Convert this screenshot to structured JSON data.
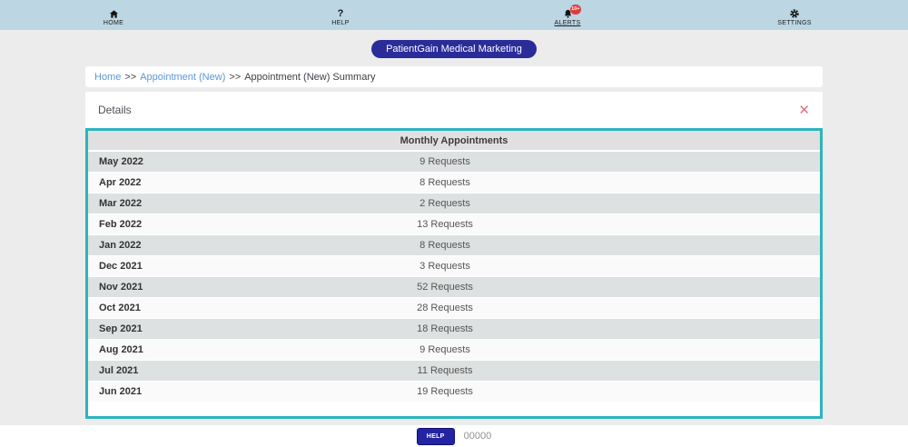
{
  "nav": {
    "items": [
      {
        "label": "HOME",
        "icon": "home-icon"
      },
      {
        "label": "HELP",
        "icon": "question-icon"
      },
      {
        "label": "ALERTS",
        "icon": "bell-icon",
        "badge": "10+"
      },
      {
        "label": "SETTINGS",
        "icon": "gear-icon"
      }
    ]
  },
  "account_pill": {
    "label": "PatientGain Medical Marketing"
  },
  "breadcrumb": {
    "links": [
      "Home",
      "Appointment (New)"
    ],
    "separator": ">>",
    "current": "Appointment (New) Summary"
  },
  "details": {
    "title": "Details",
    "close_glyph": "✕"
  },
  "table": {
    "header": "Monthly Appointments",
    "rows": [
      {
        "month": "May 2022",
        "requests": "9 Requests"
      },
      {
        "month": "Apr 2022",
        "requests": "8 Requests"
      },
      {
        "month": "Mar 2022",
        "requests": "2 Requests"
      },
      {
        "month": "Feb 2022",
        "requests": "13 Requests"
      },
      {
        "month": "Jan 2022",
        "requests": "8 Requests"
      },
      {
        "month": "Dec 2021",
        "requests": "3 Requests"
      },
      {
        "month": "Nov 2021",
        "requests": "52 Requests"
      },
      {
        "month": "Oct 2021",
        "requests": "28 Requests"
      },
      {
        "month": "Sep 2021",
        "requests": "18 Requests"
      },
      {
        "month": "Aug 2021",
        "requests": "9 Requests"
      },
      {
        "month": "Jul 2021",
        "requests": "11 Requests"
      },
      {
        "month": "Jun 2021",
        "requests": "19 Requests"
      }
    ]
  },
  "footer": {
    "help_label": "HELP",
    "code": "00000"
  },
  "colors": {
    "topnav_bg": "#bcd6e3",
    "page_bg": "#ececec",
    "accent_navy": "#2a2c99",
    "table_border_teal": "#2cb4bd",
    "close_red": "#e9707b",
    "badge_red": "#e23b3b",
    "link_blue": "#5d96d8"
  }
}
